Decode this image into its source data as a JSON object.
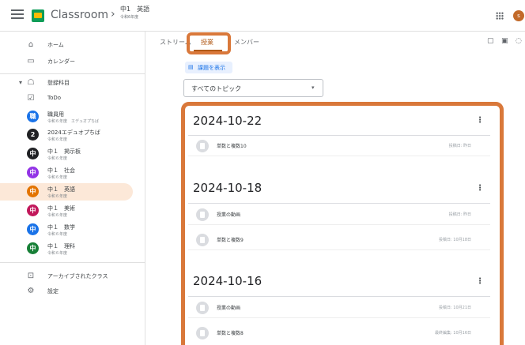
{
  "header": {
    "app_title": "Classroom",
    "chevron": "›",
    "class_name": "中1　英語",
    "class_section": "令和6年度",
    "avatar_letter": "s"
  },
  "sidebar": {
    "home": "ホーム",
    "calendar": "カレンダー",
    "enrolled": "登録科目",
    "todo": "ToDo",
    "classes": [
      {
        "name": "職員用",
        "sub": "令和６年度　エデュオプちば",
        "badge": "職",
        "color": "#1a73e8"
      },
      {
        "name": "2024エデュオプちば",
        "sub": "令和６年度",
        "badge": "2",
        "color": "#202124"
      },
      {
        "name": "中１　掲示板",
        "sub": "令和６年度",
        "badge": "中",
        "color": "#202124"
      },
      {
        "name": "中１　社会",
        "sub": "令和６年度",
        "badge": "中",
        "color": "#9334e6"
      },
      {
        "name": "中１　英語",
        "sub": "令和６年度",
        "badge": "中",
        "color": "#e37400"
      },
      {
        "name": "中１　美術",
        "sub": "令和６年度",
        "badge": "中",
        "color": "#c2185b"
      },
      {
        "name": "中１　数学",
        "sub": "令和６年度",
        "badge": "中",
        "color": "#1a73e8"
      },
      {
        "name": "中１　理科",
        "sub": "令和６年度",
        "badge": "中",
        "color": "#188038"
      }
    ],
    "archived": "アーカイブされたクラス",
    "settings": "設定"
  },
  "tabs": {
    "stream": "ストリーム",
    "classwork": "授業",
    "people": "メンバー"
  },
  "view_work": "課題を表示",
  "topic_filter": {
    "selected": "すべてのトピック"
  },
  "groups": [
    {
      "date": "2024-10-22",
      "posts": [
        {
          "title": "単数と複数10",
          "meta": "投稿日: 昨日"
        }
      ]
    },
    {
      "date": "2024-10-18",
      "posts": [
        {
          "title": "授業の動画",
          "meta": "投稿日: 昨日"
        },
        {
          "title": "単数と複数9",
          "meta": "投稿日: 10月18日"
        }
      ]
    },
    {
      "date": "2024-10-16",
      "posts": [
        {
          "title": "授業の動画",
          "meta": "投稿日: 10月21日"
        },
        {
          "title": "単数と複数8",
          "meta": "最終編集: 10月16日"
        }
      ]
    }
  ],
  "colors": {
    "accent": "#b15a17",
    "highlight_box": "#d9783a",
    "active_nav_bg": "#fce8d8"
  }
}
